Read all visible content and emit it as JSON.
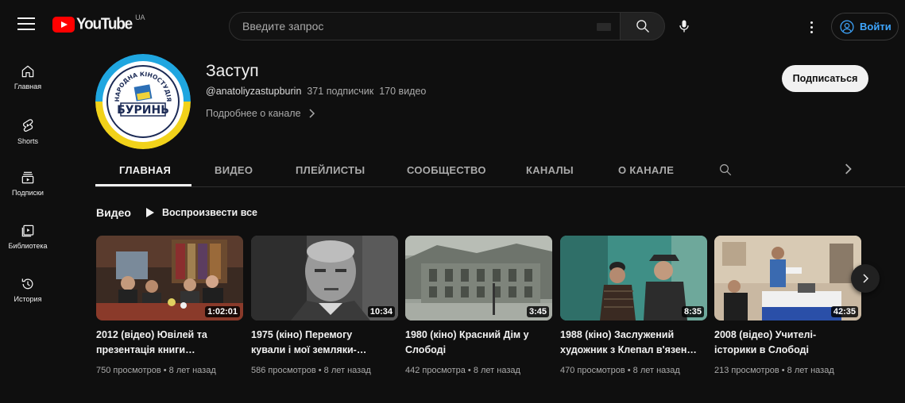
{
  "header": {
    "logo_text": "YouTube",
    "country_code": "UA",
    "search_placeholder": "Введите запрос",
    "signin_label": "Войти"
  },
  "sidebar": {
    "items": [
      {
        "label": "Главная",
        "icon": "home-icon"
      },
      {
        "label": "Shorts",
        "icon": "shorts-icon"
      },
      {
        "label": "Подписки",
        "icon": "subscriptions-icon"
      },
      {
        "label": "Библиотека",
        "icon": "library-icon"
      },
      {
        "label": "История",
        "icon": "history-icon"
      }
    ]
  },
  "channel": {
    "name": "Заступ",
    "handle": "@anatoliyzastupburin",
    "subscribers": "371 подписчик",
    "video_count": "170 видео",
    "about_link": "Подробнее о канале",
    "subscribe_label": "Подписаться",
    "avatar_text": {
      "top": "НАРОДНА КІНОСТУДІЯ",
      "bottom": "БУРИНЬ"
    }
  },
  "tabs": [
    {
      "label": "ГЛАВНАЯ",
      "active": true
    },
    {
      "label": "ВИДЕО",
      "active": false
    },
    {
      "label": "ПЛЕЙЛИСТЫ",
      "active": false
    },
    {
      "label": "СООБЩЕСТВО",
      "active": false
    },
    {
      "label": "КАНАЛЫ",
      "active": false
    },
    {
      "label": "О КАНАЛЕ",
      "active": false
    }
  ],
  "section": {
    "title": "Видео",
    "play_all": "Воспроизвести все"
  },
  "videos": [
    {
      "title_line1": "2012 (відео) Ювілей та",
      "title_line2": "презентація книги…",
      "duration": "1:02:01",
      "views": "750 просмотров",
      "age": "8 лет назад"
    },
    {
      "title_line1": "1975 (кіно) Перемогу",
      "title_line2": "кували і мої земляки-…",
      "duration": "10:34",
      "views": "586 просмотров",
      "age": "8 лет назад"
    },
    {
      "title_line1": "1980 (кіно) Красний Дім у",
      "title_line2": "Слободі",
      "duration": "3:45",
      "views": "442 просмотра",
      "age": "8 лет назад"
    },
    {
      "title_line1": "1988 (кіно) Заслужений",
      "title_line2": "художник з Клепал в'язен…",
      "duration": "8:35",
      "views": "470 просмотров",
      "age": "8 лет назад"
    },
    {
      "title_line1": "2008 (відео) Учителі-",
      "title_line2": "історики в Слободі",
      "duration": "42:35",
      "views": "213 просмотров",
      "age": "8 лет назад"
    }
  ],
  "meta_separator": "•",
  "colors": {
    "background": "#0f0f0f",
    "brand_red": "#ff0000",
    "link_blue": "#3ea6ff",
    "secondary_text": "#aaaaaa"
  }
}
